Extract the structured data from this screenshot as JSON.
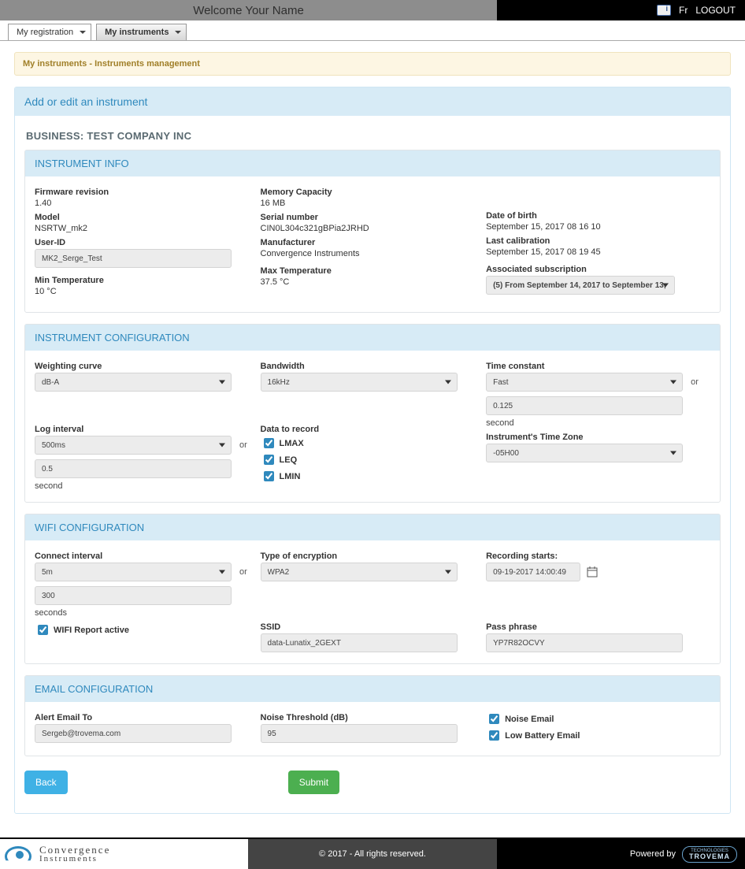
{
  "header": {
    "welcome": "Welcome  Your Name",
    "lang": "Fr",
    "logout": "LOGOUT"
  },
  "tabs": {
    "reg": "My registration",
    "instr": "My instruments"
  },
  "breadcrumb": "My instruments - Instruments management",
  "panel_title": "Add or edit an instrument",
  "business": "BUSINESS: TEST COMPANY INC",
  "sections": {
    "info": {
      "title": "INSTRUMENT INFO",
      "labels": {
        "fw": "Firmware revision",
        "model": "Model",
        "user_id": "User-ID",
        "min_temp": "Min Temperature",
        "mem": "Memory Capacity",
        "serial": "Serial number",
        "manu": "Manufacturer",
        "max_temp": "Max Temperature",
        "dob": "Date of birth",
        "last_cal": "Last calibration",
        "assoc_sub": "Associated subscription"
      },
      "values": {
        "fw": "1.40",
        "model": "NSRTW_mk2",
        "user_id": "MK2_Serge_Test",
        "min_temp": "10 °C",
        "mem": "16 MB",
        "serial": "CIN0L304c321gBPia2JRHD",
        "manu": "Convergence Instruments",
        "max_temp": "37.5 °C",
        "dob": "September 15, 2017 08 16 10",
        "last_cal": "September 15, 2017 08 19 45",
        "assoc_sub": "(5) From September 14, 2017 to September 13,"
      }
    },
    "config": {
      "title": "INSTRUMENT CONFIGURATION",
      "labels": {
        "weight": "Weighting curve",
        "log_int": "Log interval",
        "bw": "Bandwidth",
        "data_rec": "Data to record",
        "tc": "Time constant",
        "tz": "Instrument's Time Zone",
        "second": "second",
        "or": "or"
      },
      "values": {
        "weight": "dB-A",
        "log_int": "500ms",
        "log_int_manual": "0.5",
        "bw": "16kHz",
        "tc": "Fast",
        "tc_manual": "0.125",
        "tz": "-05H00"
      },
      "data_to_record": {
        "lmax": "LMAX",
        "leq": "LEQ",
        "lmin": "LMIN"
      }
    },
    "wifi": {
      "title": "WIFI CONFIGURATION",
      "labels": {
        "connect_int": "Connect interval",
        "or": "or",
        "seconds": "seconds",
        "wifi_report": "WIFI Report active",
        "enc": "Type of encryption",
        "ssid": "SSID",
        "rec_starts": "Recording starts:",
        "pass": "Pass phrase"
      },
      "values": {
        "connect_int": "5m",
        "connect_int_manual": "300",
        "enc": "WPA2",
        "ssid": "data-Lunatix_2GEXT",
        "rec_starts": "09-19-2017 14:00:49",
        "pass": "YP7R82OCVY"
      }
    },
    "email": {
      "title": "EMAIL CONFIGURATION",
      "labels": {
        "alert_to": "Alert Email To",
        "noise_thresh": "Noise Threshold (dB)",
        "noise_email": "Noise Email",
        "low_batt": "Low Battery Email"
      },
      "values": {
        "alert_to": "Sergeb@trovema.com",
        "noise_thresh": "95"
      }
    }
  },
  "buttons": {
    "back": "Back",
    "submit": "Submit"
  },
  "footer": {
    "company1": "Convergence",
    "company2": "Instruments",
    "copyright": "© 2017 - All rights reserved.",
    "powered": "Powered by",
    "trovema1": "TECHNOLOGIES",
    "trovema2": "TROVEMA"
  }
}
